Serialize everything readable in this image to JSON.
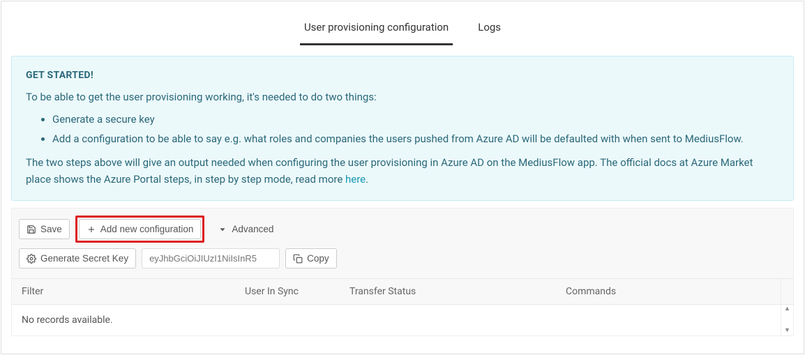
{
  "tabs": {
    "config": "User provisioning configuration",
    "logs": "Logs"
  },
  "alert": {
    "title": "GET STARTED!",
    "intro": "To be able to get the user provisioning working, it's needed to do two things:",
    "bullet1": "Generate a secure key",
    "bullet2": "Add a configuration to be able to say e.g. what roles and companies the users pushed from Azure AD will be defaulted with when sent to MediusFlow.",
    "outro_pre": "The two steps above will give an output needed when configuring the user provisioning in Azure AD on the MediusFlow app. The official docs at Azure Market place shows the Azure Portal steps, in step by step mode, read more ",
    "outro_link": "here",
    "outro_post": "."
  },
  "toolbar": {
    "save": "Save",
    "add_config": "Add new configuration",
    "advanced": "Advanced",
    "gen_key": "Generate Secret Key",
    "token_placeholder": "eyJhbGciOiJIUzI1NiIsInR5",
    "copy": "Copy"
  },
  "grid": {
    "headers": {
      "filter": "Filter",
      "user_in_sync": "User In Sync",
      "transfer_status": "Transfer Status",
      "commands": "Commands"
    },
    "empty": "No records available."
  }
}
